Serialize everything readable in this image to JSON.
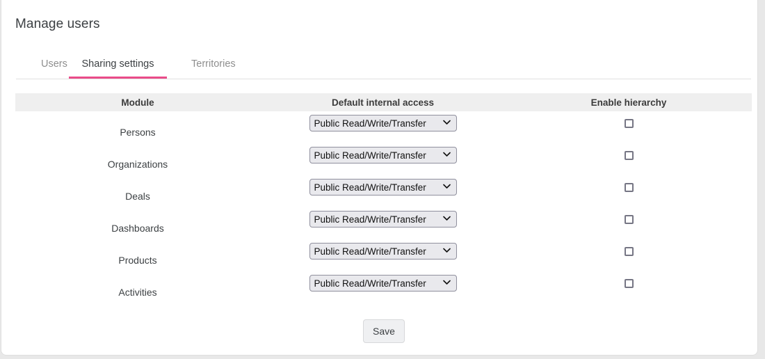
{
  "header": {
    "title": "Manage users"
  },
  "tabs": [
    {
      "label": "Users",
      "active": false
    },
    {
      "label": "Sharing settings",
      "active": true
    },
    {
      "label": "Territories",
      "active": false
    }
  ],
  "table": {
    "columns": [
      {
        "label": "Module"
      },
      {
        "label": "Default internal access"
      },
      {
        "label": "Enable hierarchy"
      }
    ],
    "rows": [
      {
        "module": "Persons",
        "access": "Public Read/Write/Transfer",
        "hierarchy_enabled": false
      },
      {
        "module": "Organizations",
        "access": "Public Read/Write/Transfer",
        "hierarchy_enabled": false
      },
      {
        "module": "Deals",
        "access": "Public Read/Write/Transfer",
        "hierarchy_enabled": false
      },
      {
        "module": "Dashboards",
        "access": "Public Read/Write/Transfer",
        "hierarchy_enabled": false
      },
      {
        "module": "Products",
        "access": "Public Read/Write/Transfer",
        "hierarchy_enabled": false
      },
      {
        "module": "Activities",
        "access": "Public Read/Write/Transfer",
        "hierarchy_enabled": false
      }
    ],
    "access_options": [
      "Public Read/Write/Transfer"
    ]
  },
  "footer": {
    "save_label": "Save"
  },
  "icons": {
    "select_chevron": "chevron-down-icon"
  },
  "colors": {
    "accent": "#ea4c89",
    "header_row_bg": "#efefef",
    "text": "#3c4043",
    "muted_text": "#8e8e8e",
    "select_bg": "#e9e9ed",
    "checkbox_border": "#767684"
  }
}
